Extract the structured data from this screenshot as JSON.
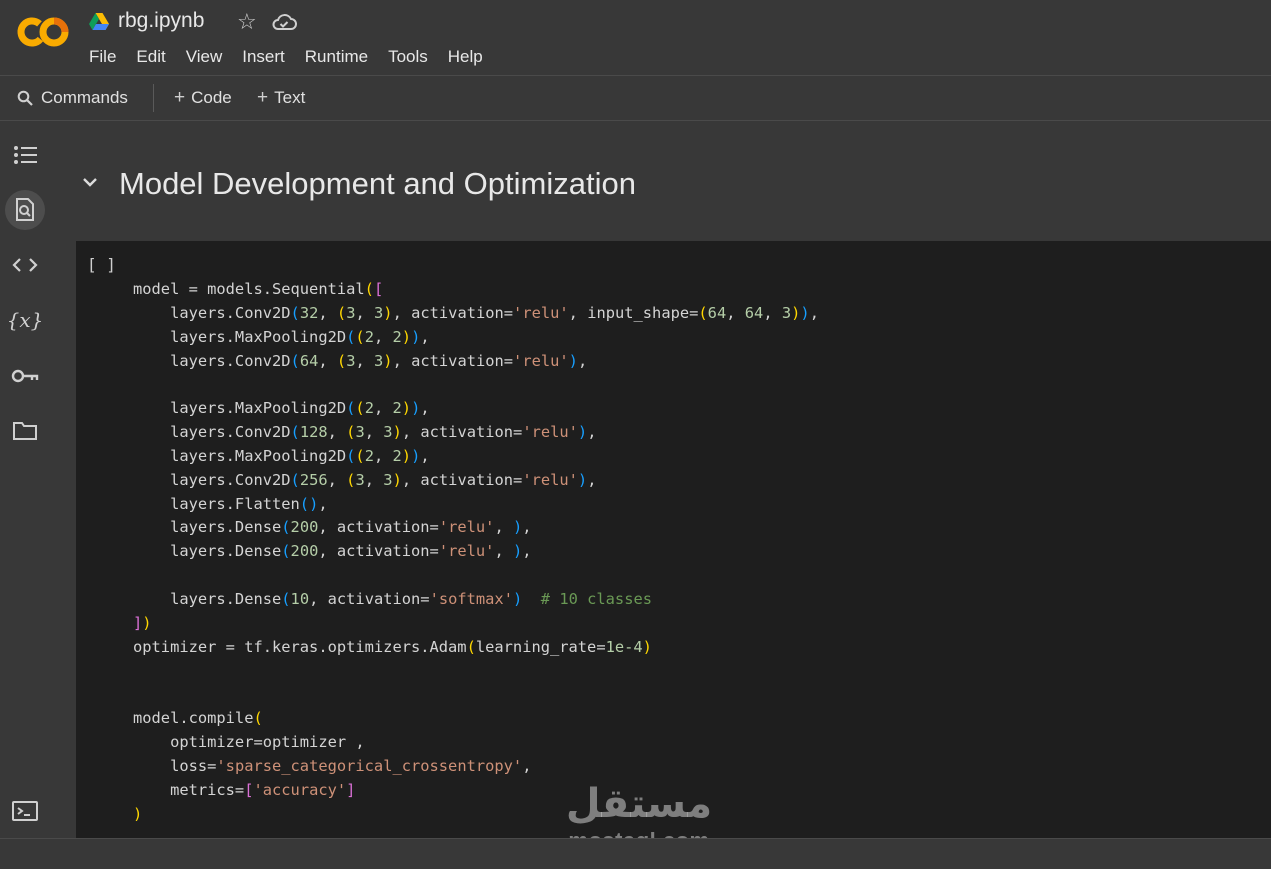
{
  "header": {
    "title": "rbg.ipynb",
    "menu": [
      "File",
      "Edit",
      "View",
      "Insert",
      "Runtime",
      "Tools",
      "Help"
    ]
  },
  "toolbar": {
    "commands_label": "Commands",
    "add_code_label": "Code",
    "add_text_label": "Text"
  },
  "sidebar": {
    "icons": [
      "table-of-contents-icon",
      "find-replace-icon",
      "code-snippets-icon",
      "variables-icon",
      "secrets-key-icon",
      "files-folder-icon",
      "terminal-icon"
    ],
    "variables_glyph": "{x}"
  },
  "section": {
    "heading": "Model Development and Optimization"
  },
  "cell": {
    "run_indicator": "[ ]",
    "code_lines": [
      [
        [
          "default",
          "model = models.Sequential"
        ],
        [
          "b1",
          "("
        ],
        [
          "b2",
          "["
        ]
      ],
      [
        [
          "default",
          "    layers.Conv2D"
        ],
        [
          "b3",
          "("
        ],
        [
          "num",
          "32"
        ],
        [
          "default",
          ", "
        ],
        [
          "b1",
          "("
        ],
        [
          "num",
          "3"
        ],
        [
          "default",
          ", "
        ],
        [
          "num",
          "3"
        ],
        [
          "b1",
          ")"
        ],
        [
          "default",
          ", activation="
        ],
        [
          "str",
          "'relu'"
        ],
        [
          "default",
          ", input_shape="
        ],
        [
          "b1",
          "("
        ],
        [
          "num",
          "64"
        ],
        [
          "default",
          ", "
        ],
        [
          "num",
          "64"
        ],
        [
          "default",
          ", "
        ],
        [
          "num",
          "3"
        ],
        [
          "b1",
          ")"
        ],
        [
          "b3",
          ")"
        ],
        [
          "default",
          ","
        ]
      ],
      [
        [
          "default",
          "    layers.MaxPooling2D"
        ],
        [
          "b3",
          "("
        ],
        [
          "b1",
          "("
        ],
        [
          "num",
          "2"
        ],
        [
          "default",
          ", "
        ],
        [
          "num",
          "2"
        ],
        [
          "b1",
          ")"
        ],
        [
          "b3",
          ")"
        ],
        [
          "default",
          ","
        ]
      ],
      [
        [
          "default",
          "    layers.Conv2D"
        ],
        [
          "b3",
          "("
        ],
        [
          "num",
          "64"
        ],
        [
          "default",
          ", "
        ],
        [
          "b1",
          "("
        ],
        [
          "num",
          "3"
        ],
        [
          "default",
          ", "
        ],
        [
          "num",
          "3"
        ],
        [
          "b1",
          ")"
        ],
        [
          "default",
          ", activation="
        ],
        [
          "str",
          "'relu'"
        ],
        [
          "b3",
          ")"
        ],
        [
          "default",
          ","
        ]
      ],
      [],
      [
        [
          "default",
          "    layers.MaxPooling2D"
        ],
        [
          "b3",
          "("
        ],
        [
          "b1",
          "("
        ],
        [
          "num",
          "2"
        ],
        [
          "default",
          ", "
        ],
        [
          "num",
          "2"
        ],
        [
          "b1",
          ")"
        ],
        [
          "b3",
          ")"
        ],
        [
          "default",
          ","
        ]
      ],
      [
        [
          "default",
          "    layers.Conv2D"
        ],
        [
          "b3",
          "("
        ],
        [
          "num",
          "128"
        ],
        [
          "default",
          ", "
        ],
        [
          "b1",
          "("
        ],
        [
          "num",
          "3"
        ],
        [
          "default",
          ", "
        ],
        [
          "num",
          "3"
        ],
        [
          "b1",
          ")"
        ],
        [
          "default",
          ", activation="
        ],
        [
          "str",
          "'relu'"
        ],
        [
          "b3",
          ")"
        ],
        [
          "default",
          ","
        ]
      ],
      [
        [
          "default",
          "    layers.MaxPooling2D"
        ],
        [
          "b3",
          "("
        ],
        [
          "b1",
          "("
        ],
        [
          "num",
          "2"
        ],
        [
          "default",
          ", "
        ],
        [
          "num",
          "2"
        ],
        [
          "b1",
          ")"
        ],
        [
          "b3",
          ")"
        ],
        [
          "default",
          ","
        ]
      ],
      [
        [
          "default",
          "    layers.Conv2D"
        ],
        [
          "b3",
          "("
        ],
        [
          "num",
          "256"
        ],
        [
          "default",
          ", "
        ],
        [
          "b1",
          "("
        ],
        [
          "num",
          "3"
        ],
        [
          "default",
          ", "
        ],
        [
          "num",
          "3"
        ],
        [
          "b1",
          ")"
        ],
        [
          "default",
          ", activation="
        ],
        [
          "str",
          "'relu'"
        ],
        [
          "b3",
          ")"
        ],
        [
          "default",
          ","
        ]
      ],
      [
        [
          "default",
          "    layers.Flatten"
        ],
        [
          "b3",
          "()"
        ],
        [
          "default",
          ","
        ]
      ],
      [
        [
          "default",
          "    layers.Dense"
        ],
        [
          "b3",
          "("
        ],
        [
          "num",
          "200"
        ],
        [
          "default",
          ", activation="
        ],
        [
          "str",
          "'relu'"
        ],
        [
          "default",
          ", "
        ],
        [
          "b3",
          ")"
        ],
        [
          "default",
          ","
        ]
      ],
      [
        [
          "default",
          "    layers.Dense"
        ],
        [
          "b3",
          "("
        ],
        [
          "num",
          "200"
        ],
        [
          "default",
          ", activation="
        ],
        [
          "str",
          "'relu'"
        ],
        [
          "default",
          ", "
        ],
        [
          "b3",
          ")"
        ],
        [
          "default",
          ","
        ]
      ],
      [],
      [
        [
          "default",
          "    layers.Dense"
        ],
        [
          "b3",
          "("
        ],
        [
          "num",
          "10"
        ],
        [
          "default",
          ", activation="
        ],
        [
          "str",
          "'softmax'"
        ],
        [
          "b3",
          ")"
        ],
        [
          "default",
          "  "
        ],
        [
          "comment",
          "# 10 classes"
        ]
      ],
      [
        [
          "b2",
          "]"
        ],
        [
          "b1",
          ")"
        ]
      ],
      [
        [
          "default",
          "optimizer = tf.keras.optimizers.Adam"
        ],
        [
          "b1",
          "("
        ],
        [
          "default",
          "learning_rate="
        ],
        [
          "num",
          "1e-4"
        ],
        [
          "b1",
          ")"
        ]
      ],
      [],
      [],
      [
        [
          "default",
          "model.compile"
        ],
        [
          "b1",
          "("
        ]
      ],
      [
        [
          "default",
          "    optimizer=optimizer ,"
        ]
      ],
      [
        [
          "default",
          "    loss="
        ],
        [
          "str",
          "'sparse_categorical_crossentropy'"
        ],
        [
          "default",
          ","
        ]
      ],
      [
        [
          "default",
          "    metrics="
        ],
        [
          "b2",
          "["
        ],
        [
          "str",
          "'accuracy'"
        ],
        [
          "b2",
          "]"
        ]
      ],
      [
        [
          "b1",
          ")"
        ]
      ]
    ]
  },
  "watermark": {
    "arabic": "مستقل",
    "latin": "mostaql.com"
  },
  "colors": {
    "background": "#383838",
    "cell_background": "#1e1e1e",
    "logo_orange": "#f9ab00",
    "logo_dark_orange": "#e8710a",
    "string": "#ce9178",
    "number": "#b5cea8",
    "comment": "#6a9955",
    "bracket_level_1": "#ffd700",
    "bracket_level_2": "#da70d6",
    "bracket_level_3": "#179fff"
  }
}
